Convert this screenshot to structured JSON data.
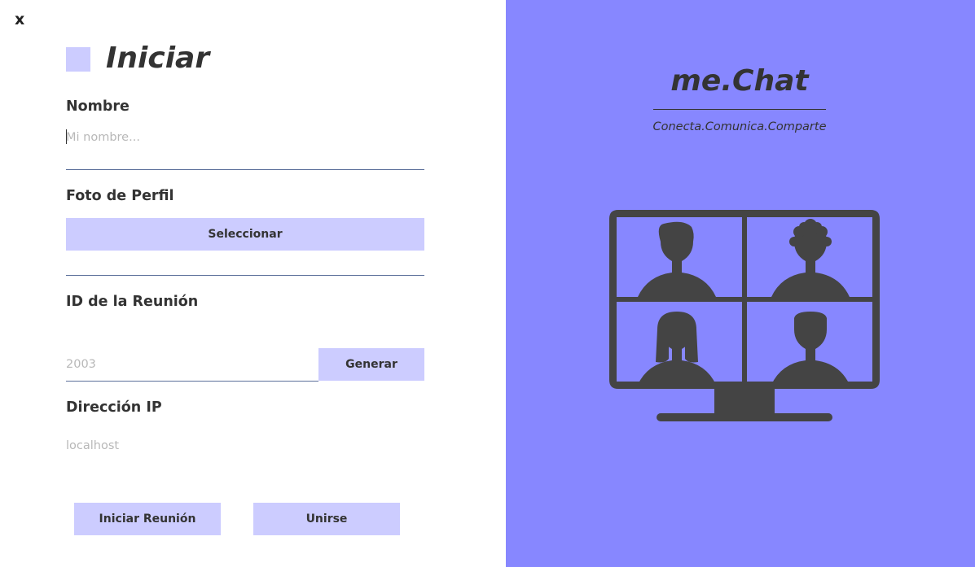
{
  "window": {
    "close_label": "x"
  },
  "form": {
    "title": "Iniciar",
    "name_label": "Nombre",
    "name_placeholder": "Mi nombre...",
    "name_value": "",
    "photo_label": "Foto de Perfil",
    "select_button": "Seleccionar",
    "meeting_id_label": "ID de la Reunión",
    "meeting_id_value": "2003",
    "generate_button": "Generar",
    "ip_label": "Dirección IP",
    "ip_value": "localhost",
    "start_button": "Iniciar Reunión",
    "join_button": "Unirse"
  },
  "brand": {
    "name": "me.Chat",
    "tagline": "Conecta.Comunica.Comparte",
    "illustration": "video-call-monitor-icon"
  },
  "colors": {
    "accent": "#ccccff",
    "brand_panel": "#8787ff",
    "text": "#333333",
    "illustration": "#444444",
    "underline": "#5b6f9a"
  }
}
